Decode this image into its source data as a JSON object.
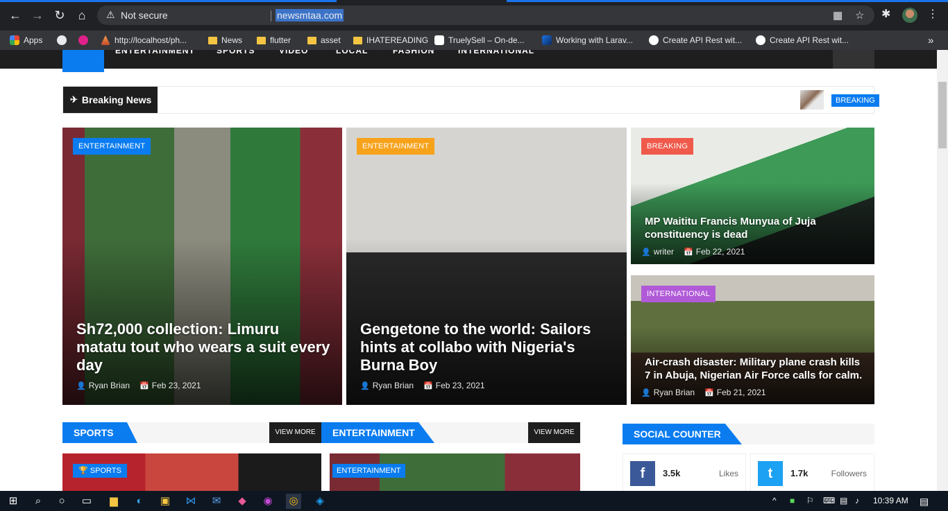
{
  "browser": {
    "security_label": "Not secure",
    "url": "newsmtaa.com",
    "bookmarks": [
      {
        "label": "Apps"
      },
      {
        "label": ""
      },
      {
        "label": ""
      },
      {
        "label": "http://localhost/ph..."
      },
      {
        "label": "News"
      },
      {
        "label": "flutter"
      },
      {
        "label": "asset"
      },
      {
        "label": "IHATEREADING"
      },
      {
        "label": "TruelySell – On-de..."
      },
      {
        "label": "Working with Larav..."
      },
      {
        "label": "Create API Rest wit..."
      },
      {
        "label": "Create API Rest wit..."
      }
    ],
    "overflow": "»"
  },
  "site": {
    "nav": [
      "ENTERTAINMENT",
      "SPORTS",
      "VIDEO",
      "LOCAL",
      "FASHION",
      "INTERNATIONAL"
    ],
    "breaking": {
      "label": "Breaking News",
      "tag": "BREAKING"
    },
    "featured": [
      {
        "category": "ENTERTAINMENT",
        "category_color": "#0a7cf0",
        "title": "Sh72,000 collection: Limuru matatu tout who wears a suit every day",
        "author": "Ryan Brian",
        "date": "Feb 23, 2021"
      },
      {
        "category": "ENTERTAINMENT",
        "category_color": "#f7a21b",
        "title": "Gengetone to the world: Sailors hints at collabo with Nigeria's Burna Boy",
        "author": "Ryan Brian",
        "date": "Feb 23, 2021"
      },
      {
        "category": "BREAKING",
        "category_color": "#f05a4b",
        "title": "MP Waititu Francis Munyua of Juja constituency is dead",
        "author": "writer",
        "date": "Feb 22, 2021"
      },
      {
        "category": "INTERNATIONAL",
        "category_color": "#b05ad8",
        "title": "Air-crash disaster: Military plane crash kills 7 in Abuja, Nigerian Air Force calls for calm.",
        "author": "Ryan Brian",
        "date": "Feb 21, 2021"
      }
    ],
    "sections": {
      "sports": {
        "title": "SPORTS",
        "more": "VIEW MORE",
        "badge": "SPORTS"
      },
      "entertainment": {
        "title": "ENTERTAINMENT",
        "more": "VIEW MORE",
        "badge": "ENTERTAINMENT"
      },
      "social": {
        "title": "SOCIAL COUNTER"
      }
    },
    "social": [
      {
        "network": "facebook",
        "glyph": "f",
        "color": "#3b5998",
        "count": "3.5k",
        "label": "Likes"
      },
      {
        "network": "twitter",
        "glyph": "t",
        "color": "#1da1f2",
        "count": "1.7k",
        "label": "Followers"
      }
    ]
  },
  "taskbar": {
    "time": "10:39 AM"
  }
}
